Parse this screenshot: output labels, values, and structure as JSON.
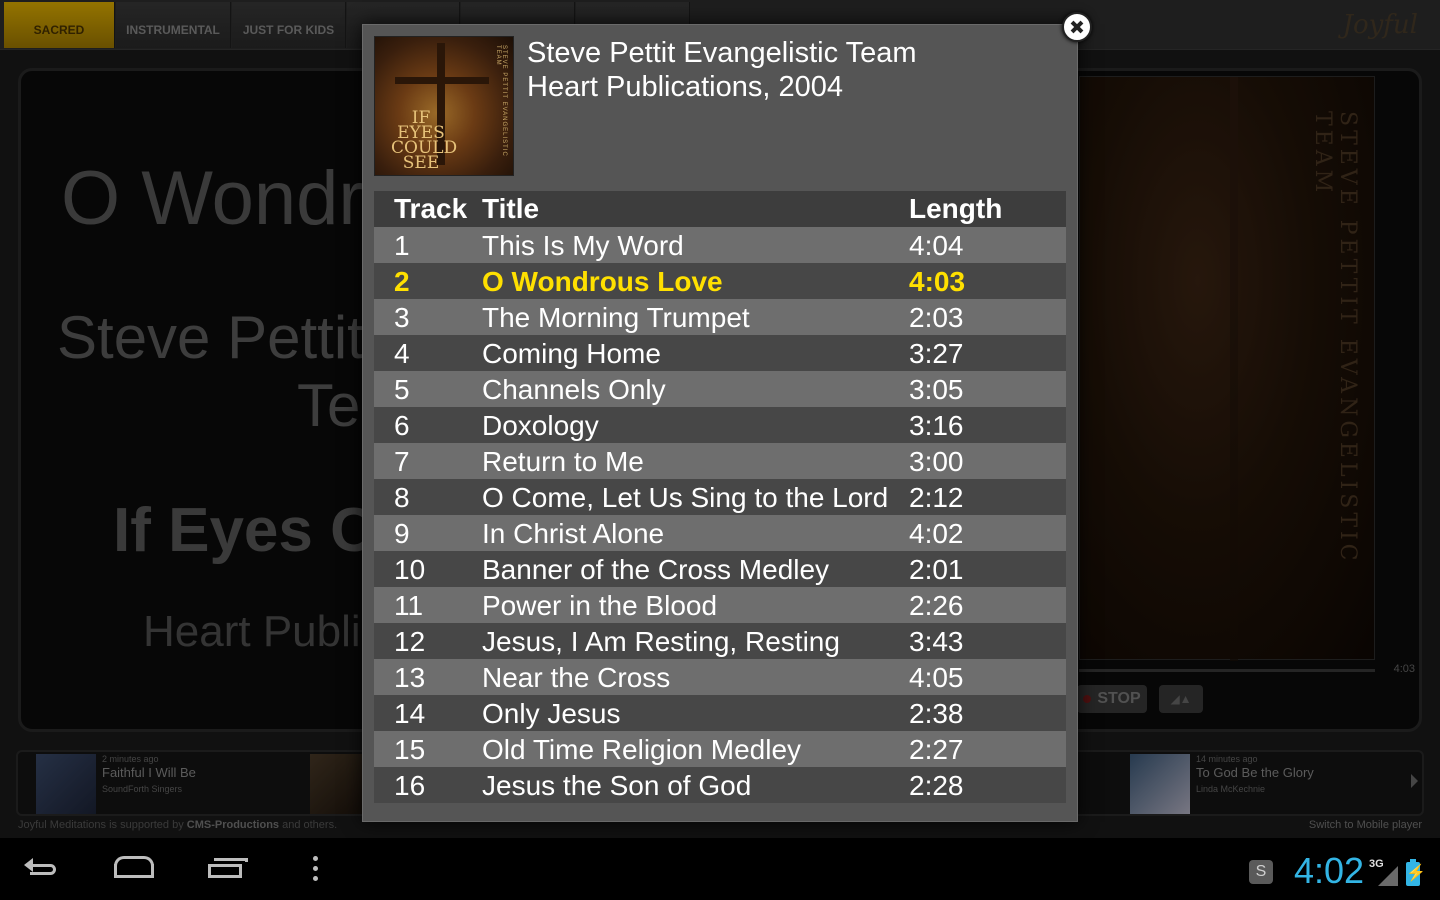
{
  "tabs": [
    {
      "label": "SACRED",
      "active": true
    },
    {
      "label": "INSTRUMENTAL",
      "active": false
    },
    {
      "label": "JUST FOR KIDS",
      "active": false
    },
    {
      "label": "",
      "active": false
    },
    {
      "label": "",
      "active": false
    },
    {
      "label": "",
      "active": false
    }
  ],
  "logo_text": "Joyful",
  "background": {
    "title": "O Wondrous Love",
    "artist_line1": "Steve Pettit Evangelistic",
    "artist_line2": "Team",
    "album": "If Eyes Could See",
    "publisher": "Heart Publications, 2004",
    "art_text": "STEVE PETTIT EVANGELISTIC TEAM",
    "time_total": "4:03",
    "stop_label": "STOP"
  },
  "recent": [
    {
      "ago": "2 minutes ago",
      "title": "Faithful I Will Be",
      "artist": "SoundForth Singers"
    },
    {
      "ago": "14 minutes ago",
      "title": "To God Be the Glory",
      "artist": "Linda McKechnie"
    }
  ],
  "footer": {
    "left_prefix": "Joyful Meditations is supported by ",
    "left_link": "CMS-Productions",
    "left_suffix": " and others.",
    "right": "Switch to Mobile player"
  },
  "dialog": {
    "artist": "Steve Pettit Evangelistic Team",
    "album_info": "Heart Publications, 2004",
    "cover_text": "IF EYES COULD SEE",
    "headers": {
      "track": "Track",
      "title": "Title",
      "length": "Length"
    },
    "current_track": 2,
    "tracks": [
      {
        "num": "1",
        "title": "This Is My Word",
        "length": "4:04"
      },
      {
        "num": "2",
        "title": "O Wondrous Love",
        "length": "4:03"
      },
      {
        "num": "3",
        "title": "The Morning Trumpet",
        "length": "2:03"
      },
      {
        "num": "4",
        "title": "Coming Home",
        "length": "3:27"
      },
      {
        "num": "5",
        "title": "Channels Only",
        "length": "3:05"
      },
      {
        "num": "6",
        "title": "Doxology",
        "length": "3:16"
      },
      {
        "num": "7",
        "title": "Return to Me",
        "length": "3:00"
      },
      {
        "num": "8",
        "title": "O Come, Let Us Sing to the Lord",
        "length": "2:12"
      },
      {
        "num": "9",
        "title": "In Christ Alone",
        "length": "4:02"
      },
      {
        "num": "10",
        "title": "Banner of the Cross Medley",
        "length": "2:01"
      },
      {
        "num": "11",
        "title": "Power in the Blood",
        "length": "2:26"
      },
      {
        "num": "12",
        "title": "Jesus, I Am Resting, Resting",
        "length": "3:43"
      },
      {
        "num": "13",
        "title": "Near the Cross",
        "length": "4:05"
      },
      {
        "num": "14",
        "title": "Only Jesus",
        "length": "2:38"
      },
      {
        "num": "15",
        "title": "Old Time Religion Medley",
        "length": "2:27"
      },
      {
        "num": "16",
        "title": "Jesus the Son of God",
        "length": "2:28"
      }
    ]
  },
  "statusbar": {
    "clock": "4:02",
    "network": "3G",
    "app_icon_letter": "S"
  },
  "colors": {
    "accent_tab": "#e3b200",
    "current_track": "#ffe000",
    "clock": "#33b5e5"
  }
}
